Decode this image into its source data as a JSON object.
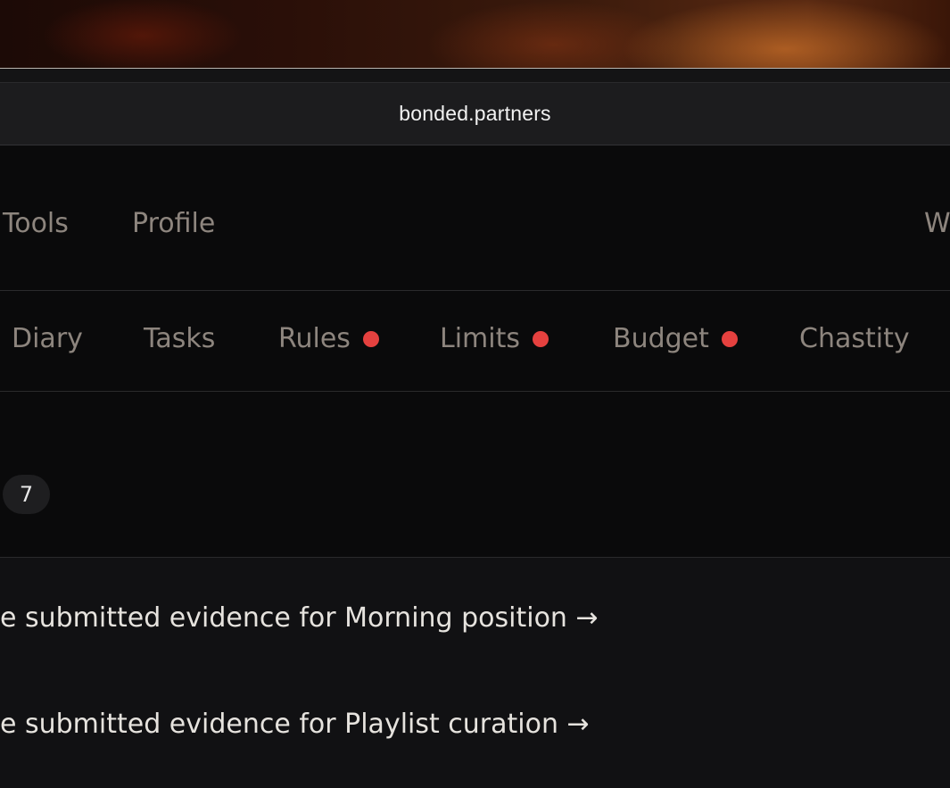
{
  "browser": {
    "url": "bonded.partners"
  },
  "top_nav": {
    "items": [
      "Tools",
      "Profile",
      "W"
    ]
  },
  "sub_nav": {
    "tabs": [
      {
        "label": "Diary",
        "badge": false
      },
      {
        "label": "Tasks",
        "badge": false
      },
      {
        "label": "Rules",
        "badge": true
      },
      {
        "label": "Limits",
        "badge": true
      },
      {
        "label": "Budget",
        "badge": true
      },
      {
        "label": "Chastity",
        "badge": false
      }
    ],
    "badge_color": "#e5413f"
  },
  "count_badge": {
    "value": "7"
  },
  "activity": {
    "items": [
      {
        "text": "e submitted evidence for Morning position →"
      },
      {
        "text": "e submitted evidence for Playlist curation →"
      }
    ]
  }
}
